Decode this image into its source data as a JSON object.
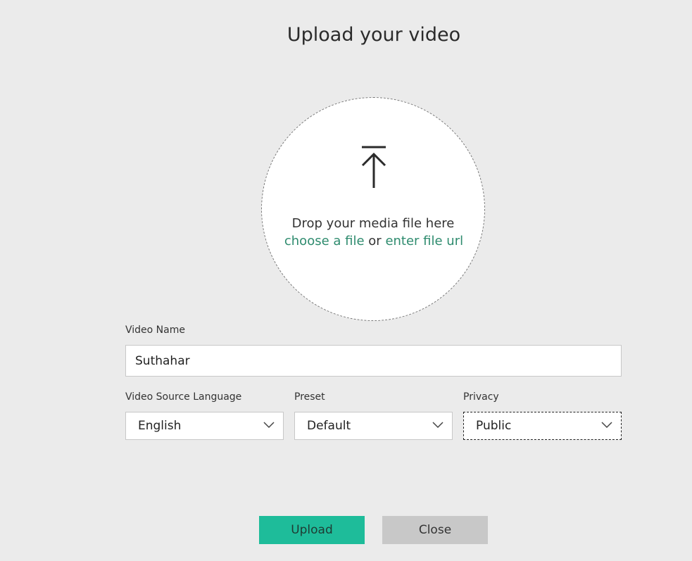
{
  "dialog": {
    "title": "Upload your video"
  },
  "dropzone": {
    "icon": "upload-arrow-icon",
    "drop_text": "Drop your media file here",
    "choose_file_link": "choose a file",
    "separator": "or",
    "enter_url_link": "enter file url",
    "link_color": "#2e8b6e"
  },
  "form": {
    "video_name": {
      "label": "Video Name",
      "value": "Suthahar"
    },
    "language": {
      "label": "Video Source Language",
      "selected": "English"
    },
    "preset": {
      "label": "Preset",
      "selected": "Default"
    },
    "privacy": {
      "label": "Privacy",
      "selected": "Public"
    }
  },
  "buttons": {
    "upload_label": "Upload",
    "close_label": "Close",
    "upload_color": "#1ebc9a",
    "close_color": "#c8c8c8"
  }
}
